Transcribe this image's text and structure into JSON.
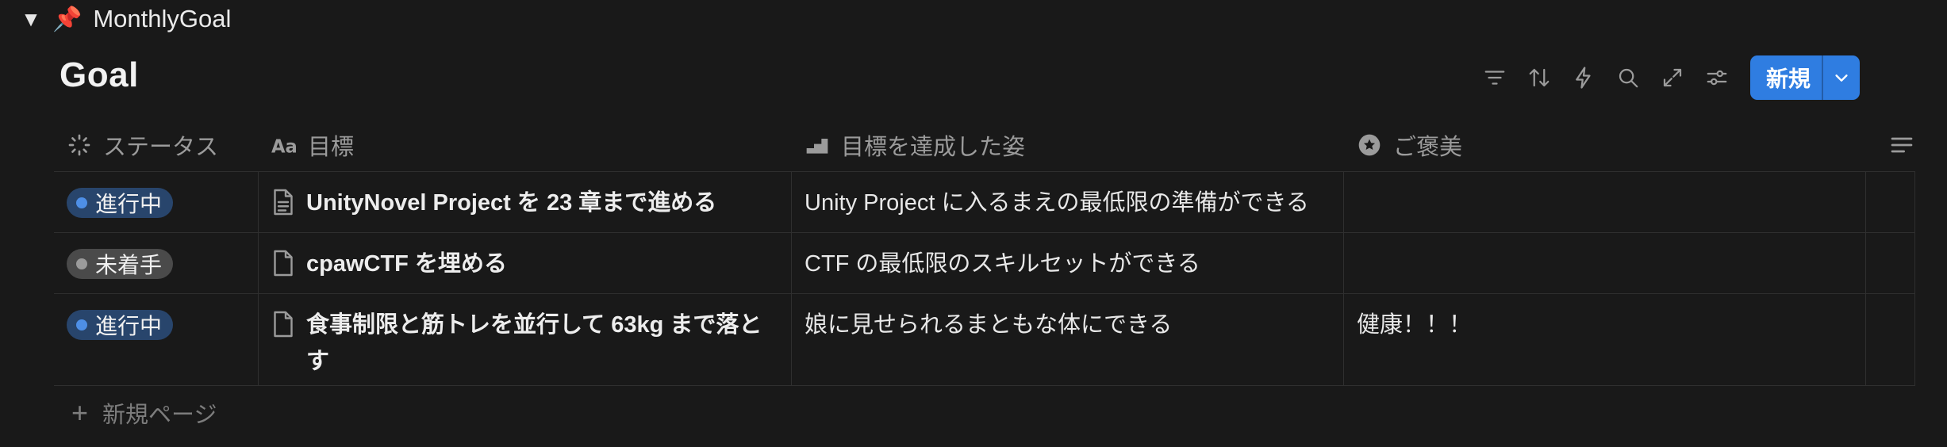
{
  "toggle": {
    "caret": "▼",
    "pin_icon": "📌",
    "label": "MonthlyGoal"
  },
  "title": "Goal",
  "toolbar": {
    "icons": [
      "filter-icon",
      "sort-icon",
      "automation-icon",
      "search-icon",
      "expand-icon",
      "settings-icon"
    ],
    "new_label": "新規",
    "accent": "#2f7de1"
  },
  "table": {
    "columns": [
      {
        "label": "ステータス",
        "icon": "status-icon"
      },
      {
        "label": "目標",
        "icon": "text-property-icon"
      },
      {
        "label": "目標を達成した姿",
        "icon": "progress-icon"
      },
      {
        "label": "ご褒美",
        "icon": "star-icon"
      }
    ],
    "rows": [
      {
        "status": "進行中",
        "status_color": "#4e8fe6",
        "goal": "UnityNovel Project を 23 章まで進める",
        "achieved": "Unity Project に入るまえの最低限の準備ができる",
        "reward": ""
      },
      {
        "status": "未着手",
        "status_color": "#9b9b9b",
        "goal": "cpawCTF を埋める",
        "achieved": "CTF の最低限のスキルセットができる",
        "reward": ""
      },
      {
        "status": "進行中",
        "status_color": "#4e8fe6",
        "goal": "食事制限と筋トレを並行して 63kg まで落とす",
        "achieved": "娘に見せられるまともな体にできる",
        "reward": "健康！！！"
      }
    ]
  },
  "new_page_label": "新規ページ"
}
